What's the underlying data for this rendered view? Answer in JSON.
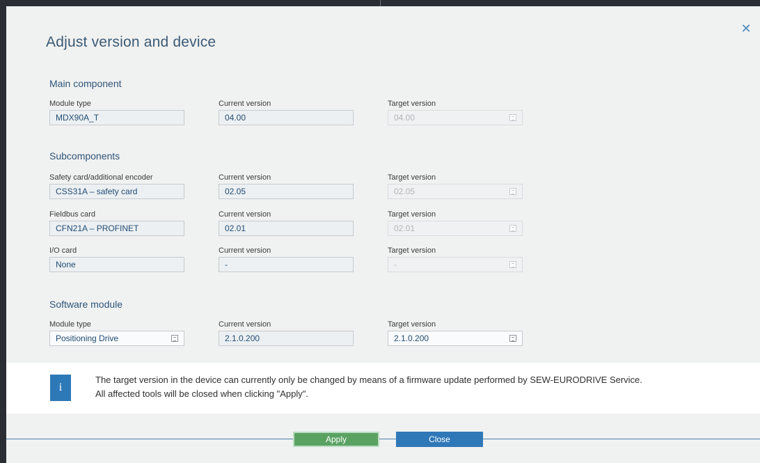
{
  "dialog": {
    "title": "Adjust version and device",
    "close_icon": "close-icon"
  },
  "main_component": {
    "heading": "Main component",
    "module_type_label": "Module type",
    "module_type_value": "MDX90A_T",
    "current_version_label": "Current version",
    "current_version_value": "04.00",
    "target_version_label": "Target version",
    "target_version_value": "04.00"
  },
  "subcomponents": {
    "heading": "Subcomponents",
    "rows": [
      {
        "type_label": "Safety card/additional encoder",
        "type_value": "CSS31A – safety card",
        "current_label": "Current version",
        "current_value": "02.05",
        "target_label": "Target version",
        "target_value": "02.05"
      },
      {
        "type_label": "Fieldbus card",
        "type_value": "CFN21A – PROFINET",
        "current_label": "Current version",
        "current_value": "02.01",
        "target_label": "Target version",
        "target_value": "02.01"
      },
      {
        "type_label": "I/O card",
        "type_value": "None",
        "current_label": "Current version",
        "current_value": "-",
        "target_label": "Target version",
        "target_value": "-"
      }
    ]
  },
  "software_module": {
    "heading": "Software module",
    "module_type_label": "Module type",
    "module_type_value": "Positioning Drive",
    "current_version_label": "Current version",
    "current_version_value": "2.1.0.200",
    "target_version_label": "Target version",
    "target_version_value": "2.1.0.200"
  },
  "info": {
    "icon": "info-icon",
    "icon_glyph": "i",
    "line1": "The target version in the device can currently only be changed by means of a firmware update performed by SEW-EURODRIVE Service.",
    "line2": "All affected tools will be closed when clicking \"Apply\"."
  },
  "buttons": {
    "apply": "Apply",
    "close": "Close"
  },
  "colors": {
    "accent": "#2f78b8",
    "apply": "#5aa262",
    "dialog_bg": "#f0f1f1"
  }
}
